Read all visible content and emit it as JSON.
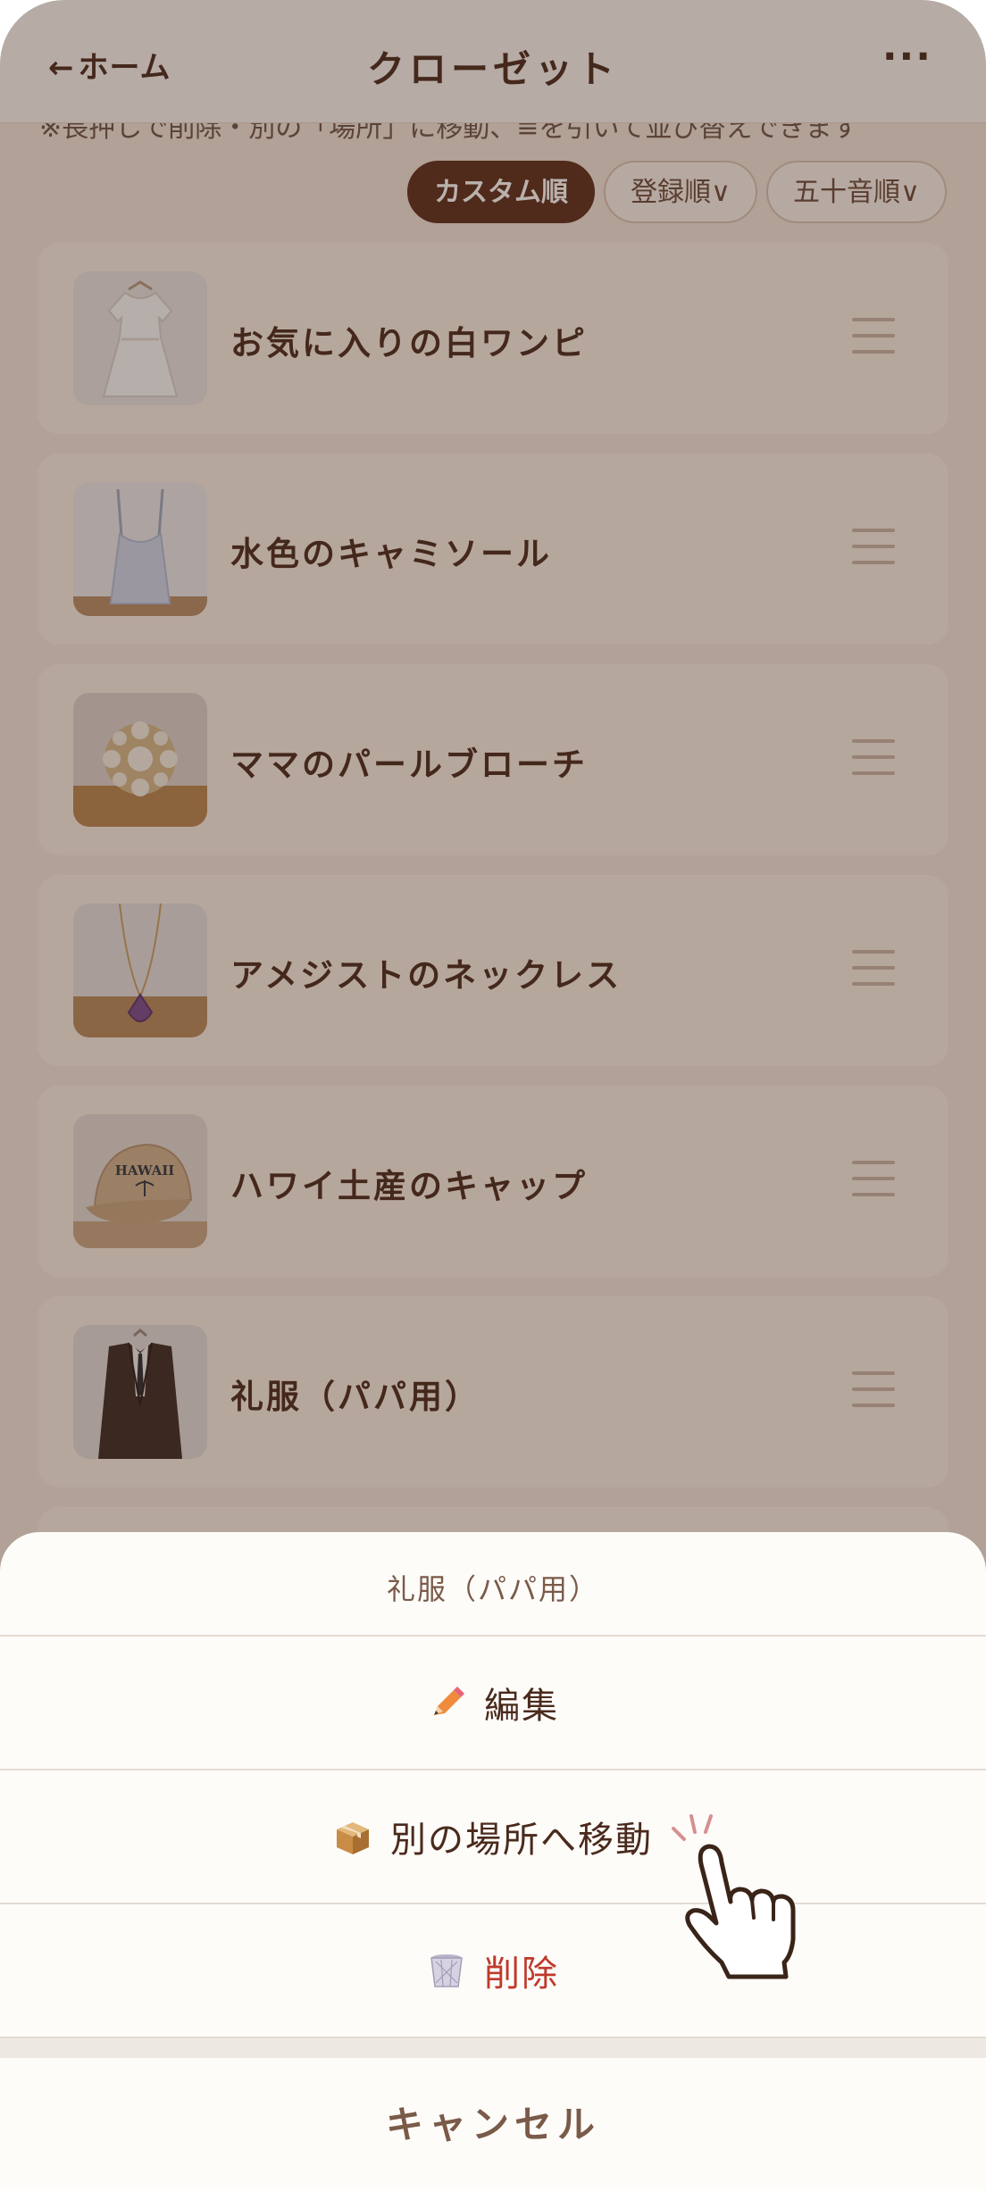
{
  "header": {
    "back_arrow": "←",
    "back_label": "ホーム",
    "title": "クローゼット",
    "more": "···"
  },
  "hint": "※長押しで削除・別の「場所」に移動、≡を引いて並び替えできます",
  "sort": {
    "options": [
      "カスタム順",
      "登録順∨",
      "五十音順∨"
    ],
    "active_index": 0
  },
  "items": [
    {
      "name": "お気に入りの白ワンピ",
      "thumb_icon": "white-dress-icon"
    },
    {
      "name": "水色のキャミソール",
      "thumb_icon": "camisole-icon"
    },
    {
      "name": "ママのパールブローチ",
      "thumb_icon": "pearl-brooch-icon"
    },
    {
      "name": "アメジストのネックレス",
      "thumb_icon": "amethyst-necklace-icon"
    },
    {
      "name": "ハワイ土産のキャップ",
      "thumb_icon": "cap-icon",
      "thumb_text": "HAWAII"
    },
    {
      "name": "礼服（パパ用）",
      "thumb_icon": "suit-icon"
    }
  ],
  "action_sheet": {
    "title": "礼服（パパ用）",
    "edit_label": "編集",
    "edit_icon": "pencil-icon",
    "move_label": "別の場所へ移動",
    "move_icon": "box-icon",
    "delete_label": "削除",
    "delete_icon": "trash-icon",
    "cancel_label": "キャンセル"
  },
  "colors": {
    "accent": "#5b2c18",
    "text": "#4a2a1c",
    "card": "#fbefe4",
    "danger": "#c0392b"
  }
}
